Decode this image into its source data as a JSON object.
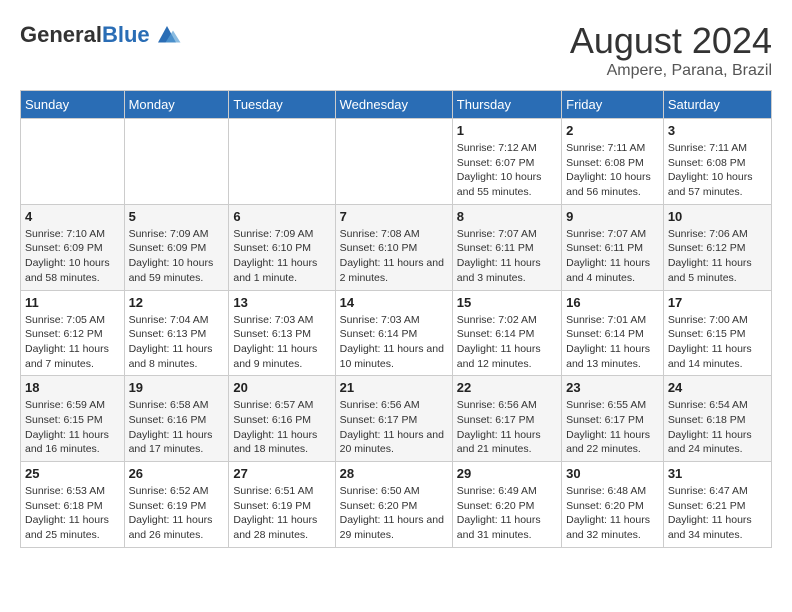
{
  "header": {
    "logo_general": "General",
    "logo_blue": "Blue",
    "month_year": "August 2024",
    "location": "Ampere, Parana, Brazil"
  },
  "days_of_week": [
    "Sunday",
    "Monday",
    "Tuesday",
    "Wednesday",
    "Thursday",
    "Friday",
    "Saturday"
  ],
  "weeks": [
    [
      {
        "day": "",
        "info": ""
      },
      {
        "day": "",
        "info": ""
      },
      {
        "day": "",
        "info": ""
      },
      {
        "day": "",
        "info": ""
      },
      {
        "day": "1",
        "info": "Sunrise: 7:12 AM\nSunset: 6:07 PM\nDaylight: 10 hours and 55 minutes."
      },
      {
        "day": "2",
        "info": "Sunrise: 7:11 AM\nSunset: 6:08 PM\nDaylight: 10 hours and 56 minutes."
      },
      {
        "day": "3",
        "info": "Sunrise: 7:11 AM\nSunset: 6:08 PM\nDaylight: 10 hours and 57 minutes."
      }
    ],
    [
      {
        "day": "4",
        "info": "Sunrise: 7:10 AM\nSunset: 6:09 PM\nDaylight: 10 hours and 58 minutes."
      },
      {
        "day": "5",
        "info": "Sunrise: 7:09 AM\nSunset: 6:09 PM\nDaylight: 10 hours and 59 minutes."
      },
      {
        "day": "6",
        "info": "Sunrise: 7:09 AM\nSunset: 6:10 PM\nDaylight: 11 hours and 1 minute."
      },
      {
        "day": "7",
        "info": "Sunrise: 7:08 AM\nSunset: 6:10 PM\nDaylight: 11 hours and 2 minutes."
      },
      {
        "day": "8",
        "info": "Sunrise: 7:07 AM\nSunset: 6:11 PM\nDaylight: 11 hours and 3 minutes."
      },
      {
        "day": "9",
        "info": "Sunrise: 7:07 AM\nSunset: 6:11 PM\nDaylight: 11 hours and 4 minutes."
      },
      {
        "day": "10",
        "info": "Sunrise: 7:06 AM\nSunset: 6:12 PM\nDaylight: 11 hours and 5 minutes."
      }
    ],
    [
      {
        "day": "11",
        "info": "Sunrise: 7:05 AM\nSunset: 6:12 PM\nDaylight: 11 hours and 7 minutes."
      },
      {
        "day": "12",
        "info": "Sunrise: 7:04 AM\nSunset: 6:13 PM\nDaylight: 11 hours and 8 minutes."
      },
      {
        "day": "13",
        "info": "Sunrise: 7:03 AM\nSunset: 6:13 PM\nDaylight: 11 hours and 9 minutes."
      },
      {
        "day": "14",
        "info": "Sunrise: 7:03 AM\nSunset: 6:14 PM\nDaylight: 11 hours and 10 minutes."
      },
      {
        "day": "15",
        "info": "Sunrise: 7:02 AM\nSunset: 6:14 PM\nDaylight: 11 hours and 12 minutes."
      },
      {
        "day": "16",
        "info": "Sunrise: 7:01 AM\nSunset: 6:14 PM\nDaylight: 11 hours and 13 minutes."
      },
      {
        "day": "17",
        "info": "Sunrise: 7:00 AM\nSunset: 6:15 PM\nDaylight: 11 hours and 14 minutes."
      }
    ],
    [
      {
        "day": "18",
        "info": "Sunrise: 6:59 AM\nSunset: 6:15 PM\nDaylight: 11 hours and 16 minutes."
      },
      {
        "day": "19",
        "info": "Sunrise: 6:58 AM\nSunset: 6:16 PM\nDaylight: 11 hours and 17 minutes."
      },
      {
        "day": "20",
        "info": "Sunrise: 6:57 AM\nSunset: 6:16 PM\nDaylight: 11 hours and 18 minutes."
      },
      {
        "day": "21",
        "info": "Sunrise: 6:56 AM\nSunset: 6:17 PM\nDaylight: 11 hours and 20 minutes."
      },
      {
        "day": "22",
        "info": "Sunrise: 6:56 AM\nSunset: 6:17 PM\nDaylight: 11 hours and 21 minutes."
      },
      {
        "day": "23",
        "info": "Sunrise: 6:55 AM\nSunset: 6:17 PM\nDaylight: 11 hours and 22 minutes."
      },
      {
        "day": "24",
        "info": "Sunrise: 6:54 AM\nSunset: 6:18 PM\nDaylight: 11 hours and 24 minutes."
      }
    ],
    [
      {
        "day": "25",
        "info": "Sunrise: 6:53 AM\nSunset: 6:18 PM\nDaylight: 11 hours and 25 minutes."
      },
      {
        "day": "26",
        "info": "Sunrise: 6:52 AM\nSunset: 6:19 PM\nDaylight: 11 hours and 26 minutes."
      },
      {
        "day": "27",
        "info": "Sunrise: 6:51 AM\nSunset: 6:19 PM\nDaylight: 11 hours and 28 minutes."
      },
      {
        "day": "28",
        "info": "Sunrise: 6:50 AM\nSunset: 6:20 PM\nDaylight: 11 hours and 29 minutes."
      },
      {
        "day": "29",
        "info": "Sunrise: 6:49 AM\nSunset: 6:20 PM\nDaylight: 11 hours and 31 minutes."
      },
      {
        "day": "30",
        "info": "Sunrise: 6:48 AM\nSunset: 6:20 PM\nDaylight: 11 hours and 32 minutes."
      },
      {
        "day": "31",
        "info": "Sunrise: 6:47 AM\nSunset: 6:21 PM\nDaylight: 11 hours and 34 minutes."
      }
    ]
  ]
}
